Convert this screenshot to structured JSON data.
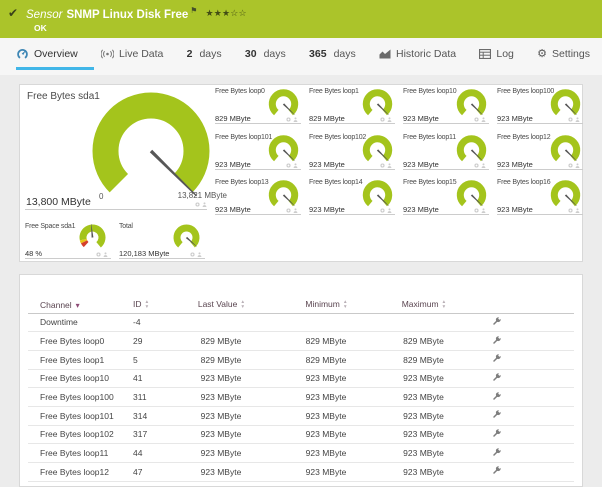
{
  "header": {
    "kind": "Sensor",
    "title": "SNMP Linux Disk Free",
    "status": "OK",
    "rating_filled": 3,
    "rating_total": 5
  },
  "tabs": [
    {
      "label": "Overview",
      "icon": "gauge",
      "active": true
    },
    {
      "label": "Live Data",
      "icon": "live"
    },
    {
      "num": "2",
      "label": "days"
    },
    {
      "num": "30",
      "label": "days"
    },
    {
      "num": "365",
      "label": "days"
    },
    {
      "label": "Historic Data",
      "icon": "chart"
    },
    {
      "label": "Log",
      "icon": "log"
    },
    {
      "label": "Settings",
      "icon": "gear"
    }
  ],
  "gauges": {
    "primary": {
      "title": "Free Bytes sda1",
      "value": "13,800 MByte",
      "scale_min": "0",
      "scale_max": "13,821 MByte",
      "fraction": 0.9985
    },
    "small": [
      {
        "title": "Free Bytes loop0",
        "value": "829 MByte",
        "fraction": 0.98
      },
      {
        "title": "Free Bytes loop1",
        "value": "829 MByte",
        "fraction": 0.98
      },
      {
        "title": "Free Bytes loop10",
        "value": "923 MByte",
        "fraction": 0.98
      },
      {
        "title": "Free Bytes loop100",
        "value": "923 MByte",
        "fraction": 0.98
      },
      {
        "title": "Free Bytes loop101",
        "value": "923 MByte",
        "fraction": 0.98
      },
      {
        "title": "Free Bytes loop102",
        "value": "923 MByte",
        "fraction": 0.98
      },
      {
        "title": "Free Bytes loop11",
        "value": "923 MByte",
        "fraction": 0.98
      },
      {
        "title": "Free Bytes loop12",
        "value": "923 MByte",
        "fraction": 0.98
      },
      {
        "title": "Free Bytes loop13",
        "value": "923 MByte",
        "fraction": 0.98
      },
      {
        "title": "Free Bytes loop14",
        "value": "923 MByte",
        "fraction": 0.98
      },
      {
        "title": "Free Bytes loop15",
        "value": "923 MByte",
        "fraction": 0.98
      },
      {
        "title": "Free Bytes loop16",
        "value": "923 MByte",
        "fraction": 0.98
      }
    ],
    "footer": [
      {
        "title": "Free Space sda1",
        "value": "48 %",
        "fraction": 0.48,
        "warning_segments": true
      },
      {
        "title": "Total",
        "value": "120,183 MByte",
        "fraction": 0.97
      }
    ]
  },
  "table": {
    "columns": [
      "Channel",
      "ID",
      "Last Value",
      "Minimum",
      "Maximum"
    ],
    "rows": [
      {
        "channel": "Downtime",
        "id": "-4",
        "last": "",
        "min": "",
        "max": ""
      },
      {
        "channel": "Free Bytes loop0",
        "id": "29",
        "last": "829 MByte",
        "min": "829 MByte",
        "max": "829 MByte"
      },
      {
        "channel": "Free Bytes loop1",
        "id": "5",
        "last": "829 MByte",
        "min": "829 MByte",
        "max": "829 MByte"
      },
      {
        "channel": "Free Bytes loop10",
        "id": "41",
        "last": "923 MByte",
        "min": "923 MByte",
        "max": "923 MByte"
      },
      {
        "channel": "Free Bytes loop100",
        "id": "311",
        "last": "923 MByte",
        "min": "923 MByte",
        "max": "923 MByte"
      },
      {
        "channel": "Free Bytes loop101",
        "id": "314",
        "last": "923 MByte",
        "min": "923 MByte",
        "max": "923 MByte"
      },
      {
        "channel": "Free Bytes loop102",
        "id": "317",
        "last": "923 MByte",
        "min": "923 MByte",
        "max": "923 MByte"
      },
      {
        "channel": "Free Bytes loop11",
        "id": "44",
        "last": "923 MByte",
        "min": "923 MByte",
        "max": "923 MByte"
      },
      {
        "channel": "Free Bytes loop12",
        "id": "47",
        "last": "923 MByte",
        "min": "923 MByte",
        "max": "923 MByte"
      }
    ]
  },
  "colors": {
    "header_green": "#abc42a",
    "gauge_green": "#a4c41c",
    "tab_underline": "#41b6e8",
    "warn_red": "#d43f2b",
    "warn_yellow": "#e8c414"
  }
}
